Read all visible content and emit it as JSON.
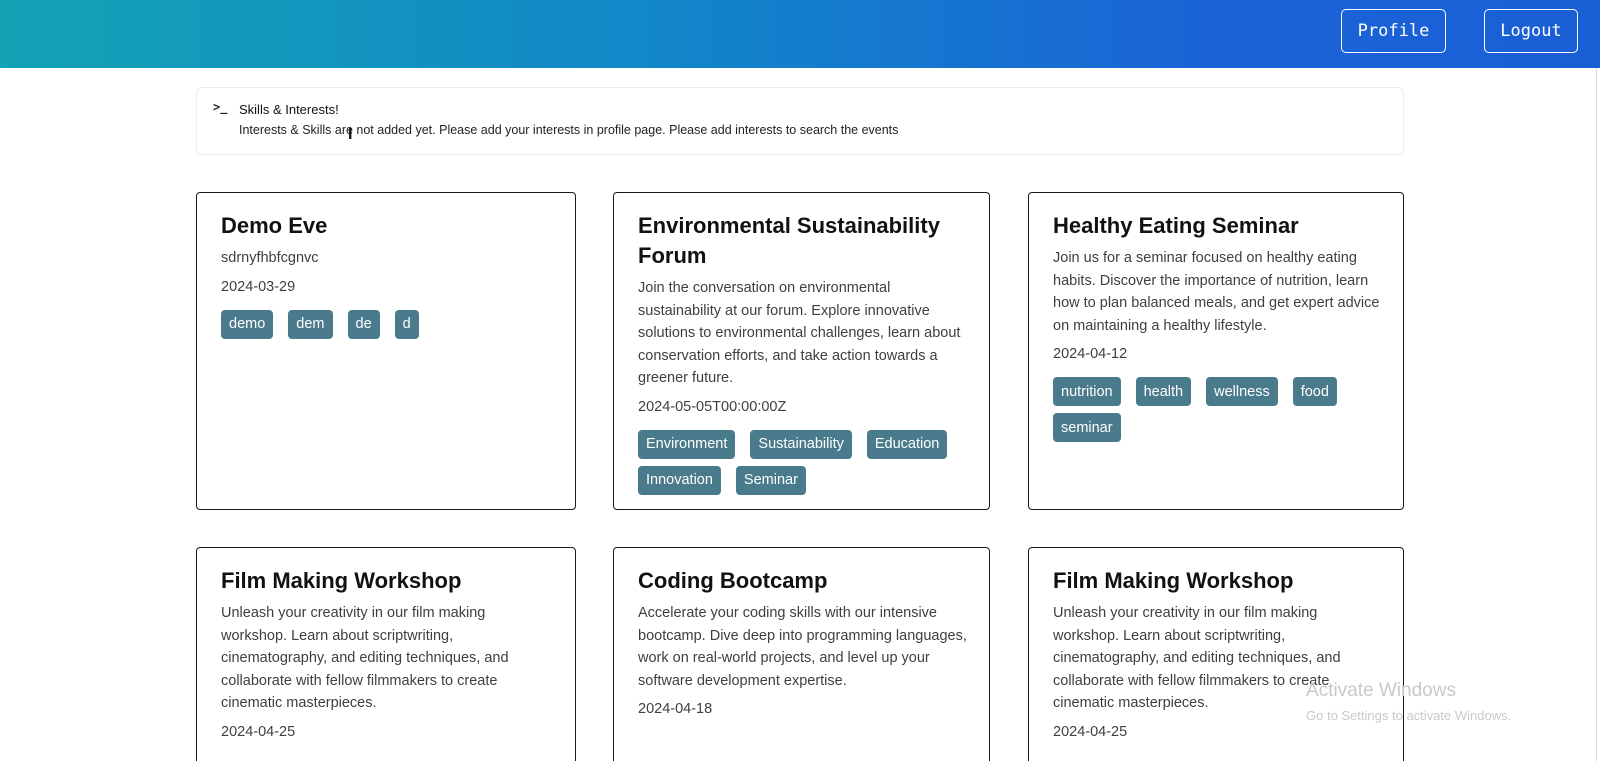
{
  "header": {
    "profile_label": "Profile",
    "logout_label": "Logout",
    "gradient_start": "#13a3b4",
    "gradient_end": "#1a5ed6"
  },
  "alert": {
    "icon": ">_",
    "title": "Skills & Interests!",
    "description": "Interests & Skills are not added yet. Please add your interests in profile page. Please add interests to search the events"
  },
  "tag_color": "#4a7b8c",
  "events": [
    {
      "title": "Demo Eve",
      "description": "sdrnyfhbfcgnvc",
      "date": "2024-03-29",
      "tags": [
        "demo",
        "dem",
        "de",
        "d"
      ]
    },
    {
      "title": "Environmental Sustainability Forum",
      "description": "Join the conversation on environmental sustainability at our forum. Explore innovative solutions to environmental challenges, learn about conservation efforts, and take action towards a greener future.",
      "date": "2024-05-05T00:00:00Z",
      "tags": [
        "Environment",
        "Sustainability",
        "Education",
        "Innovation",
        "Seminar"
      ]
    },
    {
      "title": "Healthy Eating Seminar",
      "description": "Join us for a seminar focused on healthy eating habits. Discover the importance of nutrition, learn how to plan balanced meals, and get expert advice on maintaining a healthy lifestyle.",
      "date": "2024-04-12",
      "tags": [
        "nutrition",
        "health",
        "wellness",
        "food",
        "seminar"
      ]
    },
    {
      "title": "Film Making Workshop",
      "description": "Unleash your creativity in our film making workshop. Learn about scriptwriting, cinematography, and editing techniques, and collaborate with fellow filmmakers to create cinematic masterpieces.",
      "date": "2024-04-25",
      "tags": []
    },
    {
      "title": "Coding Bootcamp",
      "description": "Accelerate your coding skills with our intensive bootcamp. Dive deep into programming languages, work on real-world projects, and level up your software development expertise.",
      "date": "2024-04-18",
      "tags": []
    },
    {
      "title": "Film Making Workshop",
      "description": "Unleash your creativity in our film making workshop. Learn about scriptwriting, cinematography, and editing techniques, and collaborate with fellow filmmakers to create cinematic masterpieces.",
      "date": "2024-04-25",
      "tags": []
    }
  ],
  "watermark": {
    "title": "Activate Windows",
    "subtitle": "Go to Settings to activate Windows."
  }
}
